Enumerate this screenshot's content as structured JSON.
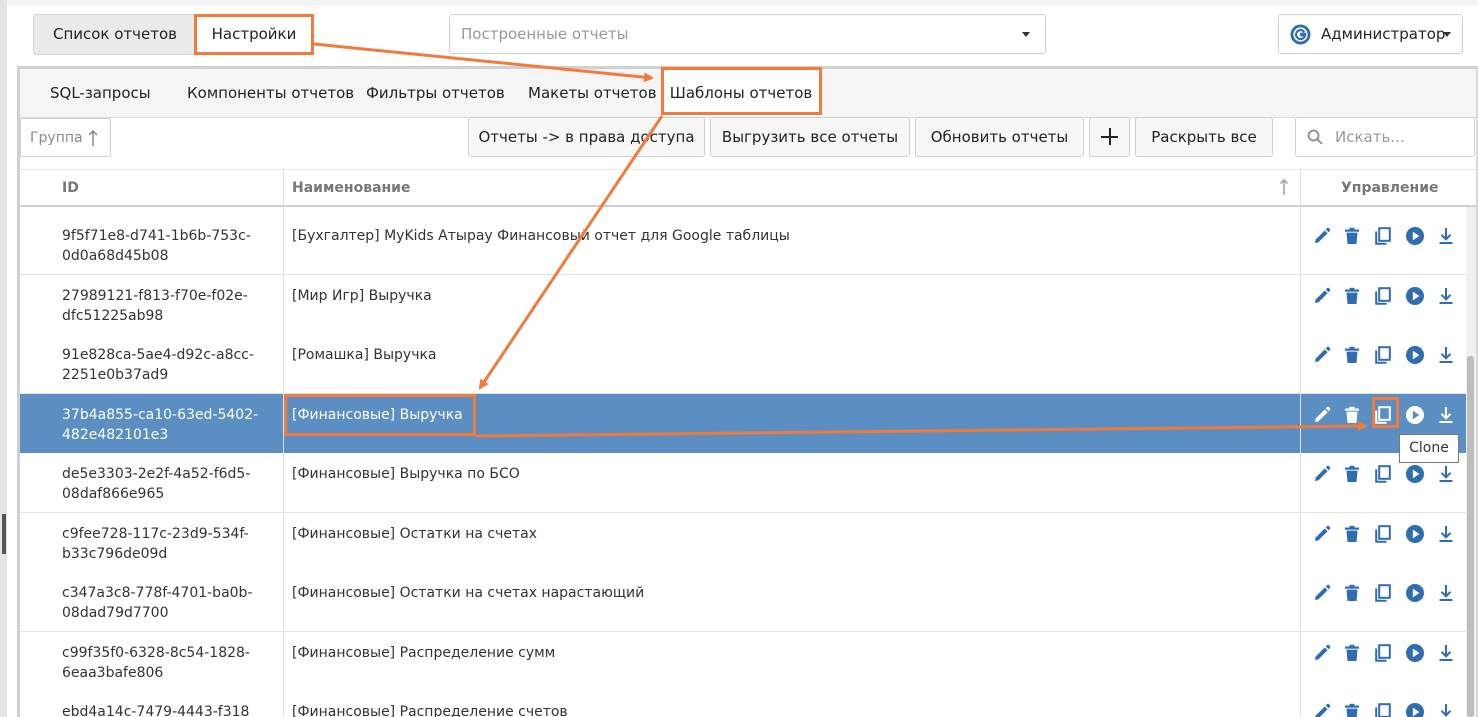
{
  "top_tabs": [
    {
      "label": "Список отчетов"
    },
    {
      "label": "Настройки"
    }
  ],
  "reports_select": {
    "placeholder": "Построенные отчеты"
  },
  "user_menu": {
    "label": "Администратор"
  },
  "sub_tabs": [
    {
      "label": "SQL-запросы"
    },
    {
      "label": "Компоненты отчетов"
    },
    {
      "label": "Фильтры отчетов"
    },
    {
      "label": "Макеты отчетов"
    },
    {
      "label": "Шаблоны отчетов"
    }
  ],
  "toolbar": {
    "group_label": "Группа",
    "reports_to_access": "Отчеты -> в права доступа",
    "export_all": "Выгрузить все отчеты",
    "refresh": "Обновить отчеты",
    "expand_all": "Раскрыть все",
    "search_placeholder": "Искать..."
  },
  "table": {
    "columns": [
      "ID",
      "Наименование",
      "Управление"
    ],
    "rows": [
      {
        "id": "9f5f71e8-d741-1b6b-753c-0d0a68d45b08",
        "name": "[Бухгалтер] MyKids Атырау Финансовый отчет для Google таблицы",
        "selected": false
      },
      {
        "id": "27989121-f813-f70e-f02e-dfc51225ab98",
        "name": "[Мир Игр] Выручка",
        "selected": false
      },
      {
        "id": "91e828ca-5ae4-d92c-a8cc-2251e0b37ad9",
        "name": "[Ромашка] Выручка",
        "selected": false
      },
      {
        "id": "37b4a855-ca10-63ed-5402-482e482101e3",
        "name": "[Финансовые] Выручка",
        "selected": true
      },
      {
        "id": "de5e3303-2e2f-4a52-f6d5-08daf866e965",
        "name": "[Финансовые] Выручка по БСО",
        "selected": false
      },
      {
        "id": "c9fee728-117c-23d9-534f-b33c796de09d",
        "name": "[Финансовые] Остатки на счетах",
        "selected": false
      },
      {
        "id": "c347a3c8-778f-4701-ba0b-08dad79d7700",
        "name": "[Финансовые] Остатки на счетах нарастающий",
        "selected": false
      },
      {
        "id": "c99f35f0-6328-8c54-1828-6eaa3bafe806",
        "name": "[Финансовые] Распределение сумм",
        "selected": false
      },
      {
        "id": "ebd4a14c-7479-4443-f318",
        "name": "[Финансовые] Распределение счетов",
        "selected": false
      }
    ]
  },
  "tooltip": {
    "text": "Clone"
  },
  "colors": {
    "accent": "#2f6db0",
    "selected_row": "#5b8fc4",
    "annotation": "#f07b3c"
  },
  "icons": [
    "globe-icon",
    "sort-up-arrow-icon",
    "plus-icon",
    "search-icon",
    "edit-icon",
    "trash-icon",
    "clone-icon",
    "play-icon",
    "download-icon"
  ]
}
